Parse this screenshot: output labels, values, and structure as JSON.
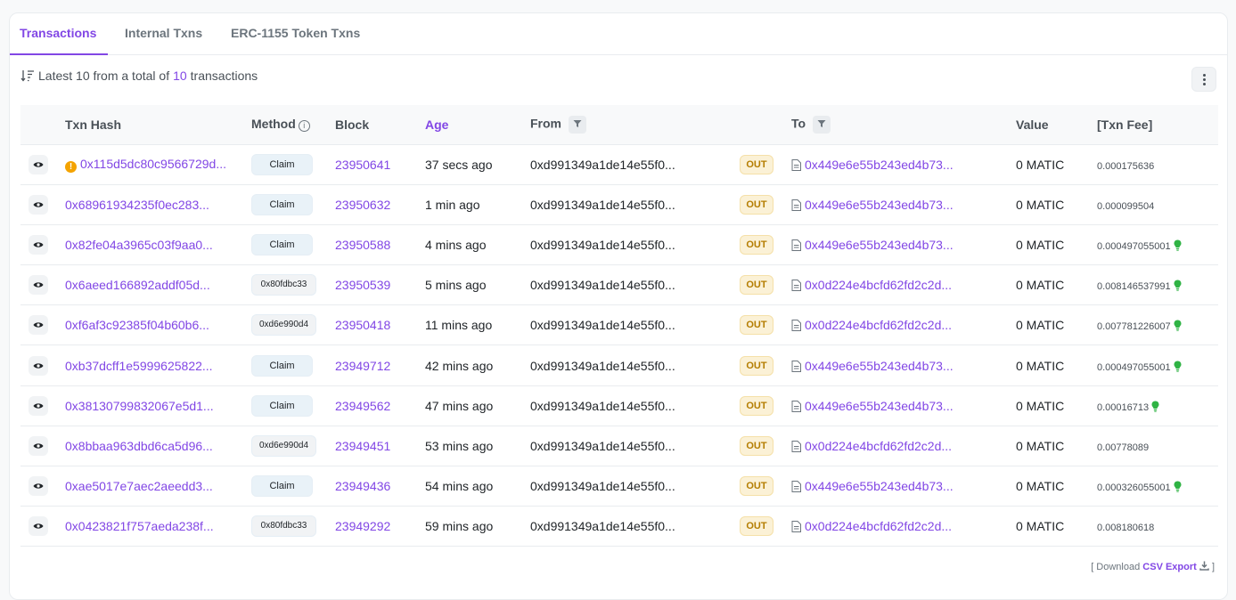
{
  "tabs": [
    {
      "label": "Transactions"
    },
    {
      "label": "Internal Txns"
    },
    {
      "label": "ERC-1155 Token Txns"
    }
  ],
  "summary": {
    "prefix": "Latest 10 from a total of",
    "count": "10",
    "suffix": "transactions"
  },
  "table": {
    "headers": {
      "hash": "Txn Hash",
      "method": "Method",
      "block": "Block",
      "age": "Age",
      "from": "From",
      "to": "To",
      "value": "Value",
      "fee": "[Txn Fee]"
    },
    "rows": [
      {
        "hash": "0x115d5dc80c9566729d...",
        "warn": true,
        "method": "Claim",
        "method_hex": false,
        "block": "23950641",
        "age": "37 secs ago",
        "from": "0xd991349a1de14e55f0...",
        "dir": "OUT",
        "to": "0x449e6e55b243ed4b73...",
        "value": "0 MATIC",
        "fee": "0.000175636",
        "bulb": false
      },
      {
        "hash": "0x68961934235f0ec283...",
        "warn": false,
        "method": "Claim",
        "method_hex": false,
        "block": "23950632",
        "age": "1 min ago",
        "from": "0xd991349a1de14e55f0...",
        "dir": "OUT",
        "to": "0x449e6e55b243ed4b73...",
        "value": "0 MATIC",
        "fee": "0.000099504",
        "bulb": false
      },
      {
        "hash": "0x82fe04a3965c03f9aa0...",
        "warn": false,
        "method": "Claim",
        "method_hex": false,
        "block": "23950588",
        "age": "4 mins ago",
        "from": "0xd991349a1de14e55f0...",
        "dir": "OUT",
        "to": "0x449e6e55b243ed4b73...",
        "value": "0 MATIC",
        "fee": "0.000497055001",
        "bulb": true
      },
      {
        "hash": "0x6aeed166892addf05d...",
        "warn": false,
        "method": "0x80fdbc33",
        "method_hex": true,
        "block": "23950539",
        "age": "5 mins ago",
        "from": "0xd991349a1de14e55f0...",
        "dir": "OUT",
        "to": "0x0d224e4bcfd62fd2c2d...",
        "value": "0 MATIC",
        "fee": "0.008146537991",
        "bulb": true
      },
      {
        "hash": "0xf6af3c92385f04b60b6...",
        "warn": false,
        "method": "0xd6e990d4",
        "method_hex": true,
        "block": "23950418",
        "age": "11 mins ago",
        "from": "0xd991349a1de14e55f0...",
        "dir": "OUT",
        "to": "0x0d224e4bcfd62fd2c2d...",
        "value": "0 MATIC",
        "fee": "0.007781226007",
        "bulb": true
      },
      {
        "hash": "0xb37dcff1e5999625822...",
        "warn": false,
        "method": "Claim",
        "method_hex": false,
        "block": "23949712",
        "age": "42 mins ago",
        "from": "0xd991349a1de14e55f0...",
        "dir": "OUT",
        "to": "0x449e6e55b243ed4b73...",
        "value": "0 MATIC",
        "fee": "0.000497055001",
        "bulb": true
      },
      {
        "hash": "0x38130799832067e5d1...",
        "warn": false,
        "method": "Claim",
        "method_hex": false,
        "block": "23949562",
        "age": "47 mins ago",
        "from": "0xd991349a1de14e55f0...",
        "dir": "OUT",
        "to": "0x449e6e55b243ed4b73...",
        "value": "0 MATIC",
        "fee": "0.00016713",
        "bulb": true
      },
      {
        "hash": "0x8bbaa963dbd6ca5d96...",
        "warn": false,
        "method": "0xd6e990d4",
        "method_hex": true,
        "block": "23949451",
        "age": "53 mins ago",
        "from": "0xd991349a1de14e55f0...",
        "dir": "OUT",
        "to": "0x0d224e4bcfd62fd2c2d...",
        "value": "0 MATIC",
        "fee": "0.00778089",
        "bulb": false
      },
      {
        "hash": "0xae5017e7aec2aeedd3...",
        "warn": false,
        "method": "Claim",
        "method_hex": false,
        "block": "23949436",
        "age": "54 mins ago",
        "from": "0xd991349a1de14e55f0...",
        "dir": "OUT",
        "to": "0x449e6e55b243ed4b73...",
        "value": "0 MATIC",
        "fee": "0.000326055001",
        "bulb": true
      },
      {
        "hash": "0x0423821f757aeda238f...",
        "warn": false,
        "method": "0x80fdbc33",
        "method_hex": true,
        "block": "23949292",
        "age": "59 mins ago",
        "from": "0xd991349a1de14e55f0...",
        "dir": "OUT",
        "to": "0x0d224e4bcfd62fd2c2d...",
        "value": "0 MATIC",
        "fee": "0.008180618",
        "bulb": false
      }
    ]
  },
  "footer": {
    "open": "[ Download",
    "csv": "CSV Export",
    "close": "]"
  },
  "colors": {
    "accent": "#8247e5",
    "out_badge": "#fbf1d6",
    "warning": "#f4a300",
    "bulb": "#2fb344"
  }
}
